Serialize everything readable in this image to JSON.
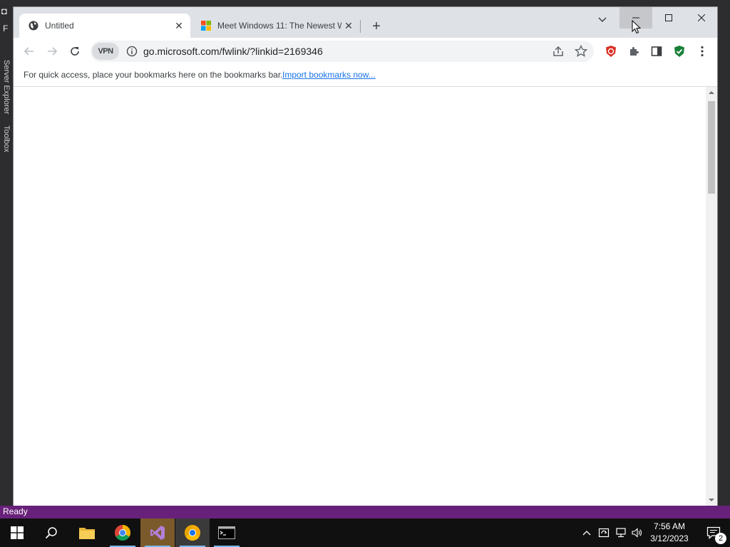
{
  "vs": {
    "logo_glyph": "◘",
    "menu_initial": "F",
    "side_tabs": [
      "Server Explorer",
      "Toolbox"
    ],
    "status_text": "Ready"
  },
  "chrome": {
    "tabs": [
      {
        "title": "Untitled",
        "icon": "globe-icon",
        "active": true
      },
      {
        "title": "Meet Windows 11: The Newest W",
        "icon": "microsoft-logo-icon",
        "active": false
      }
    ],
    "tab_close_glyph": "✕",
    "new_tab_glyph": "+",
    "url": "go.microsoft.com/fwlink/?linkid=2169346",
    "vpn_label": "VPN",
    "bookmarks_bar": {
      "message": "For quick access, place your bookmarks here on the bookmarks bar.",
      "link": "Import bookmarks now..."
    }
  },
  "taskbar": {
    "apps": [
      "windows-start",
      "search",
      "file-explorer",
      "chrome",
      "visual-studio",
      "chrome-canary",
      "command-prompt"
    ],
    "clock": {
      "time": "7:56 AM",
      "date": "3/12/2023"
    },
    "notification_count": "2"
  },
  "colors": {
    "vs_statusbar": "#68217a",
    "chrome_tabstrip": "#dee1e6",
    "link": "#1a73e8",
    "taskbar": "#101010"
  }
}
